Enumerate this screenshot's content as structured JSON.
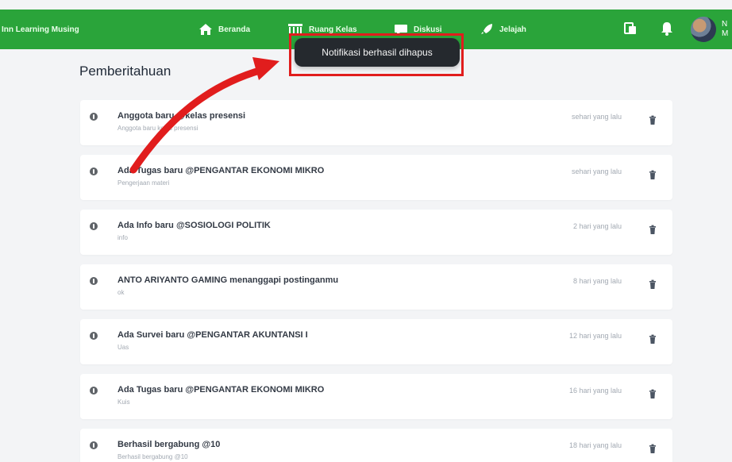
{
  "app": {
    "brand": "Inn Learning Musing"
  },
  "nav": [
    {
      "label": "Beranda",
      "icon": "home-icon"
    },
    {
      "label": "Ruang Kelas",
      "icon": "classroom-icon"
    },
    {
      "label": "Diskusi",
      "icon": "chat-icon"
    },
    {
      "label": "Jelajah",
      "icon": "rocket-icon"
    }
  ],
  "topbar_icons": [
    "copy-icon",
    "bell-icon"
  ],
  "user": {
    "name_cut": "N\nM"
  },
  "toast": {
    "message": "Notifikasi berhasil dihapus"
  },
  "page": {
    "title": "Pemberitahuan"
  },
  "notifications": [
    {
      "title": "Anggota baru @kelas presensi",
      "subtitle": "Anggota baru kelas presensi",
      "time": "sehari yang lalu"
    },
    {
      "title": "Ada Tugas baru @PENGANTAR EKONOMI MIKRO",
      "subtitle": "Pengerjaan materi",
      "time": "sehari yang lalu"
    },
    {
      "title": "Ada Info baru @SOSIOLOGI POLITIK",
      "subtitle": "info",
      "time": "2 hari yang lalu"
    },
    {
      "title": "ANTO ARIYANTO GAMING menanggapi postinganmu",
      "subtitle": "ok",
      "time": "8 hari yang lalu"
    },
    {
      "title": "Ada Survei baru @PENGANTAR AKUNTANSI I",
      "subtitle": "Uas",
      "time": "12 hari yang lalu"
    },
    {
      "title": "Ada Tugas baru @PENGANTAR EKONOMI MIKRO",
      "subtitle": "Kuis",
      "time": "16 hari yang lalu"
    },
    {
      "title": "Berhasil bergabung @10",
      "subtitle": "Berhasil bergabung @10",
      "time": "18 hari yang lalu"
    }
  ],
  "colors": {
    "topbar": "#2aa43a",
    "toast_bg": "#25292e",
    "highlight": "#e11d1d",
    "page_bg": "#f3f4f6"
  }
}
